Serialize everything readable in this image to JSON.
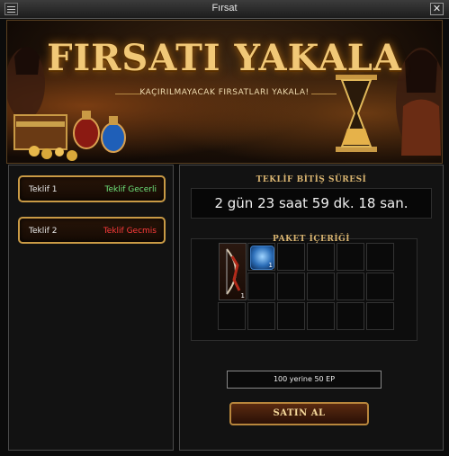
{
  "window": {
    "title": "Fırsat"
  },
  "banner": {
    "heading": "FIRSATI YAKALA",
    "subheading": "KAÇIRILMAYACAK FIRSATLARI YAKALA!"
  },
  "offers": [
    {
      "name": "Teklif 1",
      "status": "Teklif Gecerli",
      "status_color": "#6ee37a"
    },
    {
      "name": "Teklif 2",
      "status": "Teklif Gecmis",
      "status_color": "#ff3b3b"
    }
  ],
  "offer_detail": {
    "end_time_title": "TEKLİF BİTİŞ SÜRESİ",
    "countdown": "2 gün 23 saat 59 dk. 18 san.",
    "package_title": "PAKET İÇERİĞİ",
    "items": [
      {
        "icon": "bow-icon",
        "quantity": "1"
      },
      {
        "icon": "scroll-icon",
        "quantity": "1"
      }
    ],
    "price_text": "100 yerine 50 EP",
    "buy_label": "SATIN AL"
  },
  "colors": {
    "gold_accent": "#c99a45",
    "valid_status": "#6ee37a",
    "expired_status": "#ff3b3b"
  }
}
